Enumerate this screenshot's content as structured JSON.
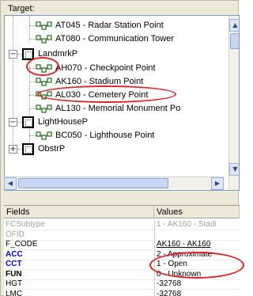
{
  "target_label": "Target:",
  "tree": {
    "items": [
      {
        "kind": "feature",
        "label": "AT045 - Radar Station Point"
      },
      {
        "kind": "feature",
        "label": "AT080 - Communication Tower"
      },
      {
        "kind": "layer",
        "expander": "−",
        "label": "LandmrkP"
      },
      {
        "kind": "feature",
        "label": "AH070 - Checkpoint Point"
      },
      {
        "kind": "feature",
        "label": "AK160 - Stadium Point",
        "selected": true
      },
      {
        "kind": "feature",
        "label": "AL030 - Cemetery Point"
      },
      {
        "kind": "feature",
        "label": "AL130 - Memorial Monument Po"
      },
      {
        "kind": "layer",
        "expander": "−",
        "label": "LightHouseP"
      },
      {
        "kind": "feature",
        "label": "BC050 - Lighthouse Point"
      },
      {
        "kind": "layer",
        "expander": "+",
        "label": "ObstrP"
      }
    ],
    "scroll_up": "▲",
    "scroll_down": "▼",
    "scroll_left": "◀",
    "scroll_right": "▶"
  },
  "grid": {
    "headers": {
      "fields": "Fields",
      "values": "Values"
    },
    "rows": [
      {
        "field": "FCSubtype",
        "value": "1 - AK160 - Stadi",
        "style": "disabled"
      },
      {
        "field": "OFID",
        "value": "",
        "style": "disabled"
      },
      {
        "field": "F_CODE",
        "value": "AK160 - AK160",
        "style": "normal"
      },
      {
        "field": "ACC",
        "value": "2 - Approximate",
        "style": "required"
      },
      {
        "field": "CCT",
        "value": "1 - Open",
        "style": "required"
      },
      {
        "field": "FUN",
        "value": "0 - Unknown",
        "style": "bold"
      },
      {
        "field": "HGT",
        "value": "-32768",
        "style": "normal"
      },
      {
        "field": "LMC",
        "value": "-32768",
        "style": "normal"
      }
    ]
  },
  "colors": {
    "annotation": "#d8262b",
    "required_field": "#0000c8",
    "disabled_field": "#a0a0a0",
    "feature_icon": "#3d7f37"
  }
}
